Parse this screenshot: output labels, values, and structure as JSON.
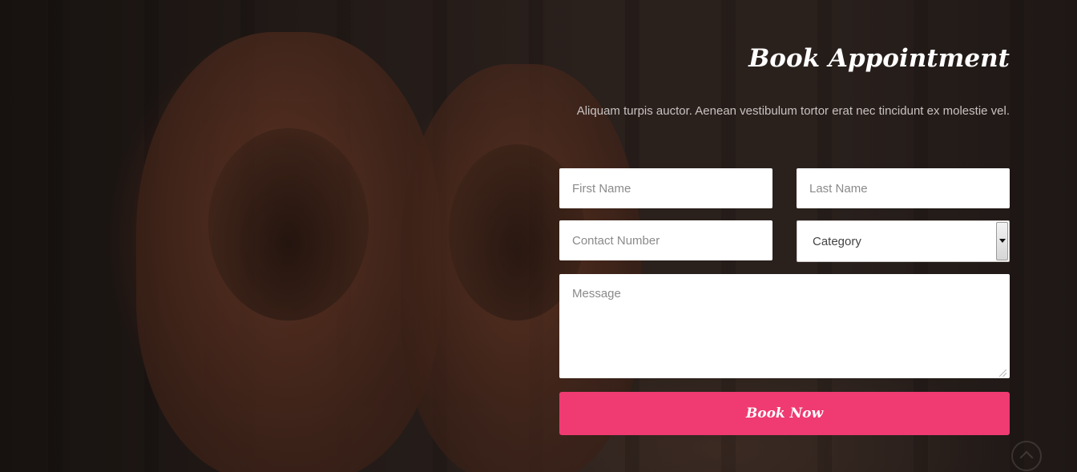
{
  "section": {
    "title": "Book Appointment",
    "description": "Aliquam turpis auctor. Aenean vestibulum tortor erat nec tincidunt ex molestie vel."
  },
  "form": {
    "first_name_placeholder": "First Name",
    "last_name_placeholder": "Last Name",
    "contact_placeholder": "Contact Number",
    "category_selected": "Category",
    "message_placeholder": "Message",
    "submit_label": "Book Now"
  },
  "icons": {
    "scroll_top": "chevron-up-icon",
    "dropdown": "caret-down-icon"
  },
  "colors": {
    "accent": "#ef3a72",
    "overlay": "#1c1513"
  }
}
